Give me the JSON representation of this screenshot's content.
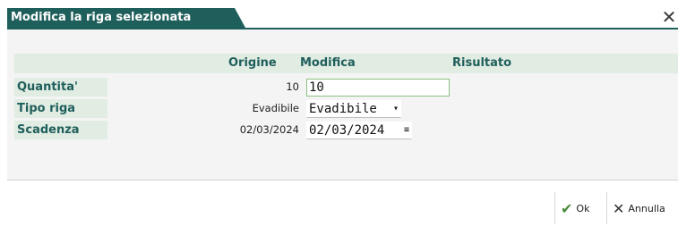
{
  "dialog": {
    "title": "Modifica la riga selezionata",
    "close_glyph": "✕",
    "close_icon": "close-icon"
  },
  "table": {
    "headers": {
      "origine": "Origine",
      "modifica": "Modifica",
      "risultato": "Risultato"
    },
    "rows": [
      {
        "label": "Quantita'",
        "origine": "10",
        "modifica": "10"
      },
      {
        "label": "Tipo riga",
        "origine": "Evadibile",
        "modifica": "Evadibile"
      },
      {
        "label": "Scadenza",
        "origine": "02/03/2024",
        "modifica": "02/03/2024"
      }
    ]
  },
  "icons": {
    "dropdown": "▾",
    "calendar": "≡",
    "ok": "✔",
    "annulla": "✕"
  },
  "buttons": {
    "ok": "Ok",
    "annulla": "Annulla"
  },
  "colors": {
    "brand": "#1f5f5b",
    "header_bg": "#e1ece3",
    "focus_border": "#8cc17e"
  }
}
